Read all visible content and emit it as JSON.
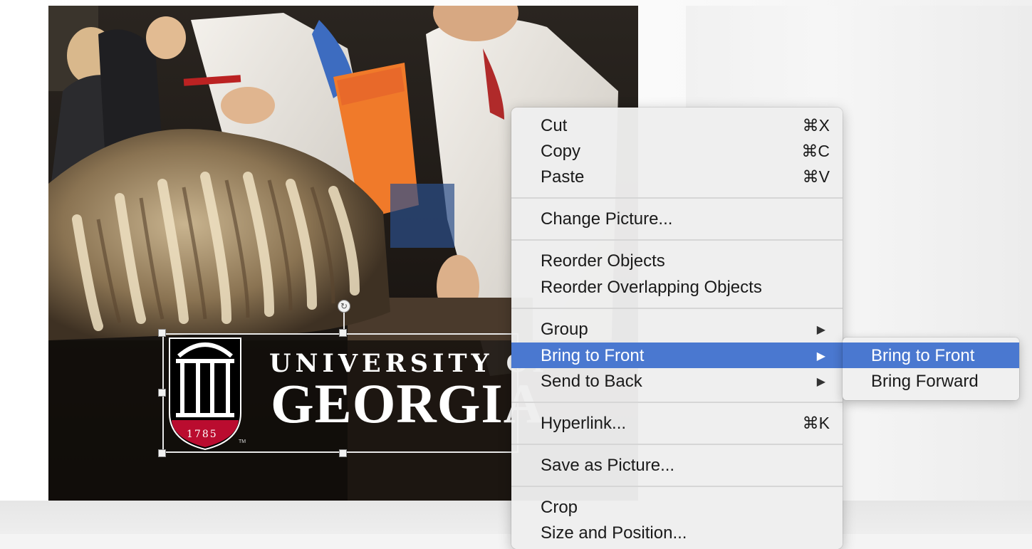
{
  "photo": {
    "logo": {
      "line1": "UNIVERSITY OF",
      "line2": "GEORGIA",
      "year": "1785",
      "trademark": "TM"
    }
  },
  "context_menu": {
    "items": [
      {
        "label": "Cut",
        "shortcut": "⌘X"
      },
      {
        "label": "Copy",
        "shortcut": "⌘C"
      },
      {
        "label": "Paste",
        "shortcut": "⌘V"
      },
      {
        "label": "Change Picture..."
      },
      {
        "label": "Reorder Objects"
      },
      {
        "label": "Reorder Overlapping Objects"
      },
      {
        "label": "Group",
        "submenu_arrow": "▶"
      },
      {
        "label": "Bring to Front",
        "submenu_arrow": "▶"
      },
      {
        "label": "Send to Back",
        "submenu_arrow": "▶"
      },
      {
        "label": "Hyperlink...",
        "shortcut": "⌘K"
      },
      {
        "label": "Save as Picture..."
      },
      {
        "label": "Crop"
      },
      {
        "label": "Size and Position..."
      }
    ]
  },
  "submenu": {
    "items": [
      {
        "label": "Bring to Front"
      },
      {
        "label": "Bring Forward"
      }
    ]
  },
  "colors": {
    "highlight": "#4a78d0",
    "uga_red": "#ba0c2f"
  }
}
